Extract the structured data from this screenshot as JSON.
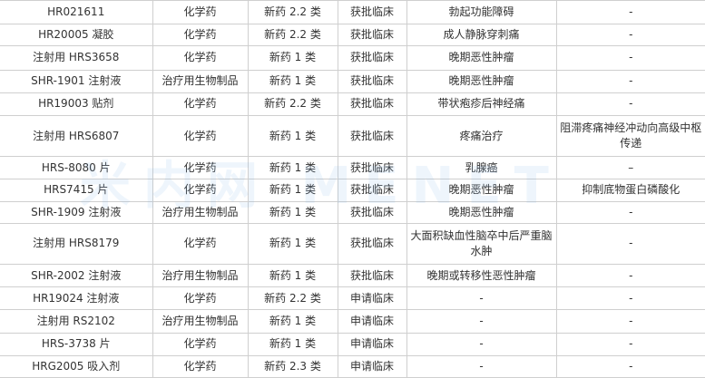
{
  "table": {
    "rows": [
      {
        "name": "HR021611",
        "type": "化学药",
        "category": "新药 2.2 类",
        "status": "获批临床",
        "indication": "勃起功能障碍",
        "mechanism": "-"
      },
      {
        "name": "HR20005 凝胶",
        "type": "化学药",
        "category": "新药 2.2 类",
        "status": "获批临床",
        "indication": "成人静脉穿刺痛",
        "mechanism": "-"
      },
      {
        "name": "注射用 HRS3658",
        "type": "化学药",
        "category": "新药 1 类",
        "status": "获批临床",
        "indication": "晚期恶性肿瘤",
        "mechanism": "-"
      },
      {
        "name": "SHR-1901 注射液",
        "type": "治疗用生物制品",
        "category": "新药 1 类",
        "status": "获批临床",
        "indication": "晚期恶性肿瘤",
        "mechanism": "-"
      },
      {
        "name": "HR19003 贴剂",
        "type": "化学药",
        "category": "新药 2.2 类",
        "status": "获批临床",
        "indication": "带状疱疹后神经痛",
        "mechanism": "-"
      },
      {
        "name": "注射用 HRS6807",
        "type": "化学药",
        "category": "新药 1 类",
        "status": "获批临床",
        "indication": "疼痛治疗",
        "mechanism": "阻滞疼痛神经冲动向高级中枢传递"
      },
      {
        "name": "HRS-8080 片",
        "type": "化学药",
        "category": "新药 1 类",
        "status": "获批临床",
        "indication": "乳腺癌",
        "mechanism": "–"
      },
      {
        "name": "HRS7415 片",
        "type": "化学药",
        "category": "新药 1 类",
        "status": "获批临床",
        "indication": "晚期恶性肿瘤",
        "mechanism": "抑制底物蛋白磷酸化"
      },
      {
        "name": "SHR-1909 注射液",
        "type": "治疗用生物制品",
        "category": "新药 1 类",
        "status": "获批临床",
        "indication": "晚期恶性肿瘤",
        "mechanism": "-"
      },
      {
        "name": "注射用 HRS8179",
        "type": "化学药",
        "category": "新药 1 类",
        "status": "获批临床",
        "indication": "大面积缺血性脑卒中后严重脑水肿",
        "mechanism": "-"
      },
      {
        "name": "SHR-2002 注射液",
        "type": "治疗用生物制品",
        "category": "新药 1 类",
        "status": "获批临床",
        "indication": "晚期或转移性恶性肿瘤",
        "mechanism": "-"
      },
      {
        "name": "HR19024 注射液",
        "type": "化学药",
        "category": "新药 2.2 类",
        "status": "申请临床",
        "indication": "-",
        "mechanism": "-"
      },
      {
        "name": "注射用 RS2102",
        "type": "治疗用生物制品",
        "category": "新药 1 类",
        "status": "申请临床",
        "indication": "-",
        "mechanism": "-"
      },
      {
        "name": "HRS-3738 片",
        "type": "化学药",
        "category": "新药 1 类",
        "status": "申请临床",
        "indication": "-",
        "mechanism": "-"
      },
      {
        "name": "HRG2005 吸入剂",
        "type": "化学药",
        "category": "新药 2.3 类",
        "status": "申请临床",
        "indication": "-",
        "mechanism": "-"
      }
    ]
  }
}
